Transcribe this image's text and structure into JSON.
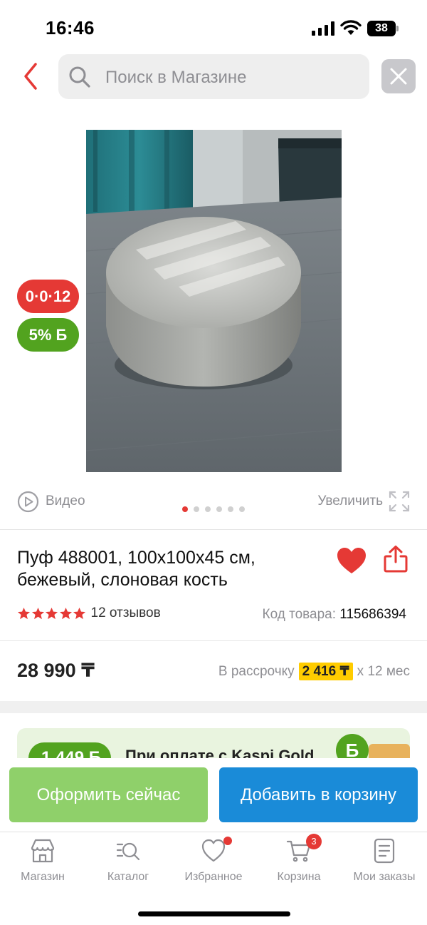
{
  "status_bar": {
    "time": "16:46",
    "battery": "38"
  },
  "search": {
    "placeholder": "Поиск в Магазине"
  },
  "badges": {
    "credit": "0·0·12",
    "bonus_percent": "5%",
    "bonus_symbol": "Б"
  },
  "media": {
    "video_label": "Видео",
    "zoom_label": "Увеличить",
    "image_count": 6,
    "active_image_index": 0
  },
  "product": {
    "title_line1": "Пуф 488001, 100x100x45 см,",
    "title_line2": "бежевый, слоновая кость",
    "rating_stars": 5,
    "reviews_label": "12 отзывов",
    "sku_label": "Код товара:",
    "sku_value": "115686394",
    "price": "28 990 ₸",
    "installment_prefix": "В рассрочку",
    "installment_amount": "2 416 ₸",
    "installment_suffix": "x 12 мес"
  },
  "promo": {
    "bonus_amount": "1 449 Б",
    "text": "При оплате с Kaspi Gold",
    "coin_symbol": "Б"
  },
  "actions": {
    "checkout_label": "Оформить сейчас",
    "cart_label": "Добавить в корзину"
  },
  "tabs": [
    {
      "label": "Магазин",
      "icon": "store-icon"
    },
    {
      "label": "Каталог",
      "icon": "catalog-search-icon"
    },
    {
      "label": "Избранное",
      "icon": "heart-outline-icon"
    },
    {
      "label": "Корзина",
      "icon": "cart-icon",
      "badge": "3"
    },
    {
      "label": "Мои заказы",
      "icon": "orders-icon"
    }
  ],
  "colors": {
    "accent_red": "#e53935",
    "bonus_green": "#52a31f",
    "checkout_green": "#8fd06a",
    "cart_blue": "#1a8bd8",
    "installment_yellow": "#ffcc00"
  }
}
